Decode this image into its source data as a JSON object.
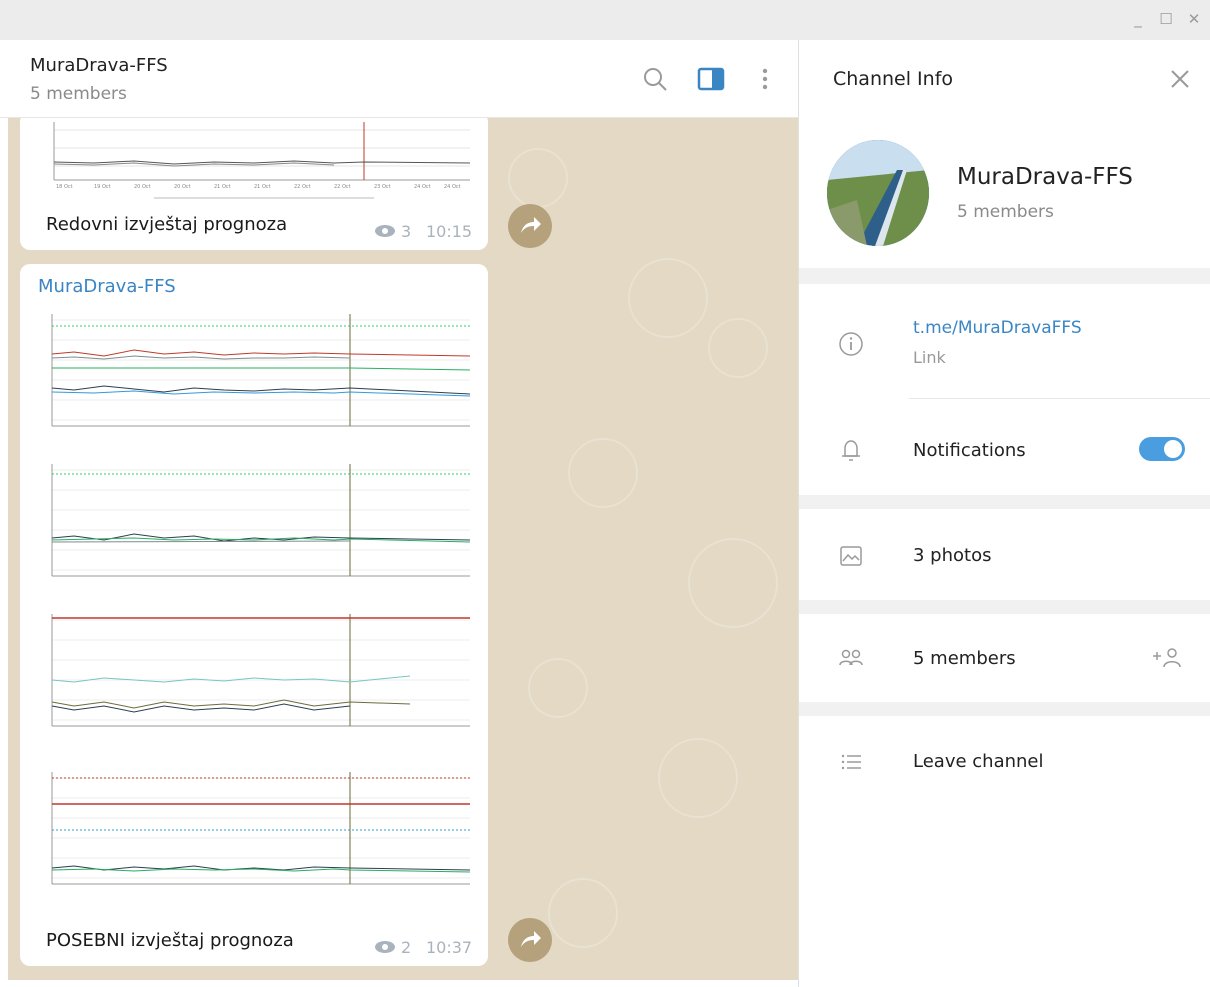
{
  "window": {
    "minimize_glyph": "_",
    "maximize_glyph": "☐",
    "close_glyph": "✕"
  },
  "chat_header": {
    "title": "MuraDrava-FFS",
    "subtitle": "5 members"
  },
  "messages": [
    {
      "caption": "Redovni izvještaj prognoza",
      "views": "3",
      "time": "10:15"
    },
    {
      "author": "MuraDrava-FFS",
      "caption": "POSEBNI izvještaj prognoza",
      "views": "2",
      "time": "10:37"
    }
  ],
  "info_panel": {
    "title": "Channel Info",
    "channel_name": "MuraDrava-FFS",
    "channel_members": "5 members",
    "link": "t.me/MuraDravaFFS",
    "link_label": "Link",
    "notifications_label": "Notifications",
    "notifications_on": true,
    "photos_label": "3 photos",
    "members_label": "5 members",
    "leave_label": "Leave channel"
  },
  "colors": {
    "accent": "#3a85c4",
    "chat_bg": "#e3d9c4",
    "forward_btn": "#b5a27c",
    "toggle_on": "#4a9ee0"
  },
  "icons": {
    "search": "search-icon",
    "sidebar_toggle": "sidebar-panel-icon",
    "more": "more-vertical-icon",
    "forward": "forward-icon",
    "views": "eye-icon",
    "close": "close-icon",
    "info": "info-icon",
    "bell": "bell-icon",
    "photos": "photo-icon",
    "members": "members-icon",
    "add_member": "add-user-icon",
    "leave": "list-icon"
  }
}
